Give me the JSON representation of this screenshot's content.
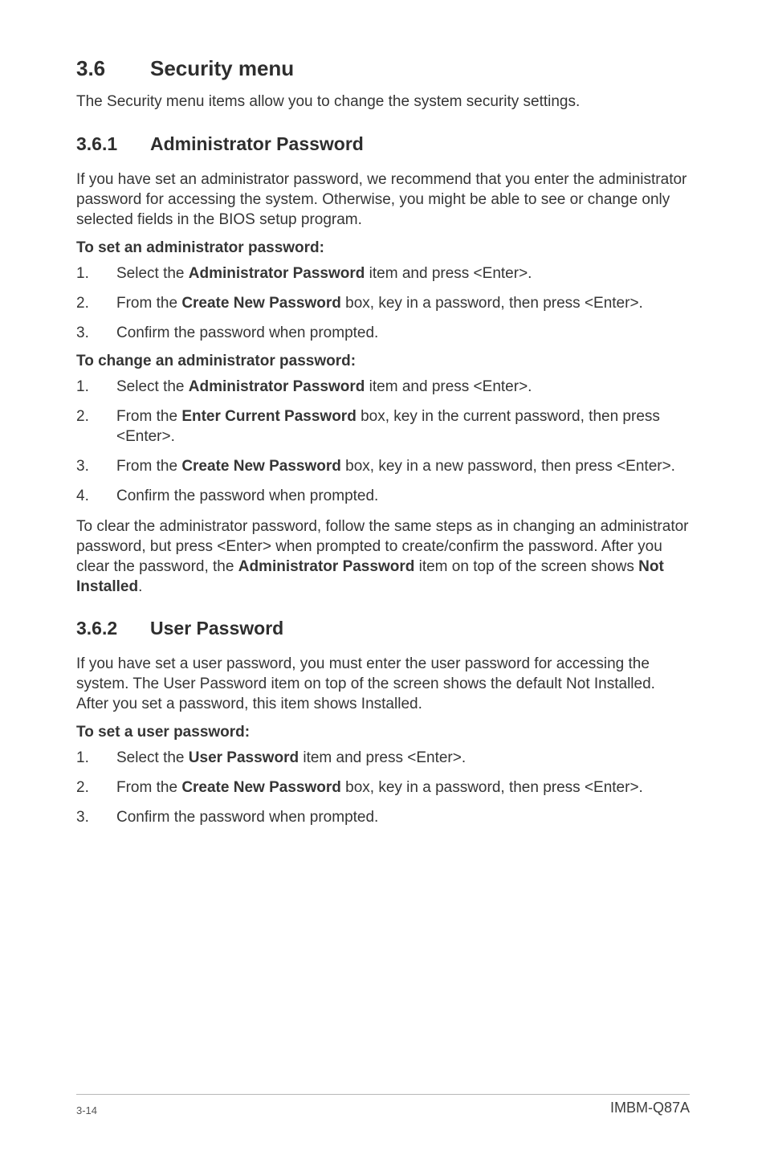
{
  "section": {
    "number": "3.6",
    "title": "Security menu",
    "intro": "The Security menu items allow you to change the system security settings."
  },
  "sub1": {
    "number": "3.6.1",
    "title": "Administrator Password",
    "intro": "If you have set an administrator password, we recommend that you enter the administrator password for accessing the system. Otherwise, you might be able to see or change only selected fields in the BIOS setup program.",
    "set_heading": "To set an administrator password:",
    "set_steps": {
      "s1_num": "1.",
      "s1_a": "Select the ",
      "s1_b": "Administrator Password",
      "s1_c": " item and press <Enter>.",
      "s2_num": "2.",
      "s2_a": "From the ",
      "s2_b": "Create New Password",
      "s2_c": " box, key in a password, then press <Enter>.",
      "s3_num": "3.",
      "s3": "Confirm the password when prompted."
    },
    "change_heading": "To change an administrator password:",
    "change_steps": {
      "c1_num": "1.",
      "c1_a": "Select the ",
      "c1_b": "Administrator Password",
      "c1_c": " item and press <Enter>.",
      "c2_num": "2.",
      "c2_a": "From the ",
      "c2_b": "Enter Current Password",
      "c2_c": " box, key in the current password, then press <Enter>.",
      "c3_num": "3.",
      "c3_a": "From the ",
      "c3_b": "Create New Password",
      "c3_c": " box, key in a new password, then press <Enter>.",
      "c4_num": "4.",
      "c4": "Confirm the password when prompted."
    },
    "clear_a": "To clear the administrator password, follow the same steps as in changing an administrator password, but press <Enter> when prompted to create/confirm the password. After you clear the password, the ",
    "clear_b": "Administrator Password",
    "clear_c": " item on top of the screen shows ",
    "clear_d": "Not Installed",
    "clear_e": "."
  },
  "sub2": {
    "number": "3.6.2",
    "title": "User Password",
    "intro": "If you have set a user password, you must enter the user password for accessing the system. The User Password item on top of the screen shows the default Not Installed. After you set a password, this item shows Installed.",
    "set_heading": "To set a user password:",
    "set_steps": {
      "u1_num": "1.",
      "u1_a": "Select the ",
      "u1_b": "User Password",
      "u1_c": " item and press <Enter>.",
      "u2_num": "2.",
      "u2_a": "From the ",
      "u2_b": "Create New Password",
      "u2_c": " box, key in a password, then press <Enter>.",
      "u3_num": "3.",
      "u3": "Confirm the password when prompted."
    }
  },
  "footer": {
    "page_number": "3-14",
    "model": "IMBM-Q87A"
  }
}
